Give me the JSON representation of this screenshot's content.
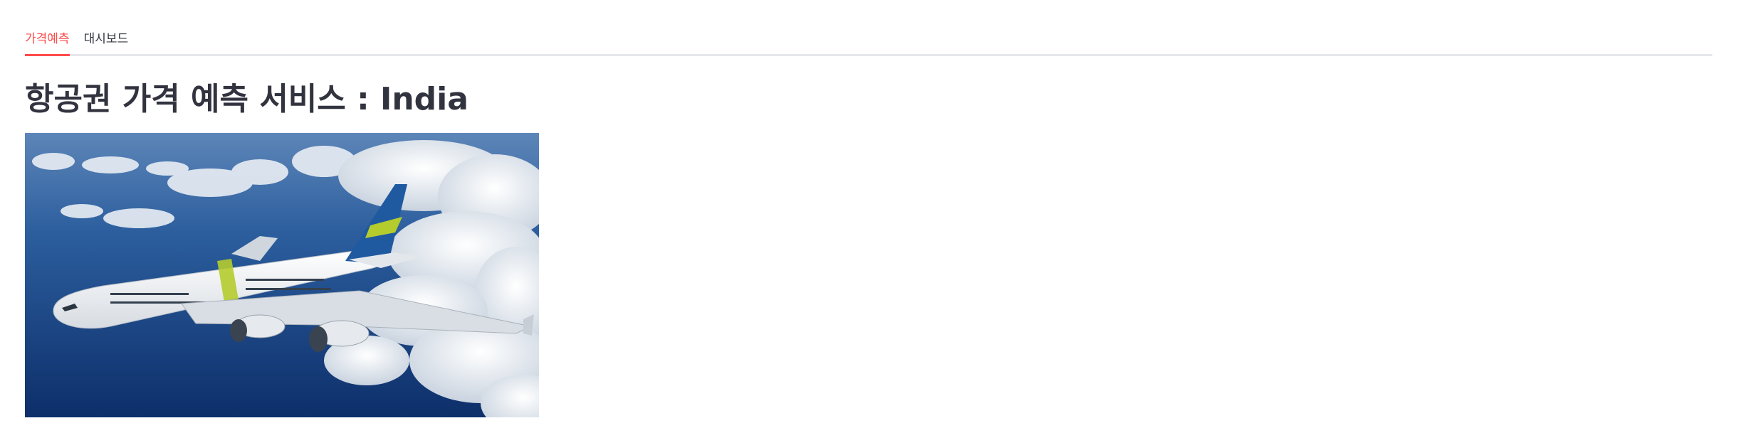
{
  "tabs": [
    {
      "label": "가격예측",
      "active": true
    },
    {
      "label": "대시보드",
      "active": false
    }
  ],
  "page": {
    "title": "항공권 가격 예측 서비스 : India"
  },
  "colors": {
    "accent": "#ff4b4b",
    "text": "#31333f",
    "divider": "#e6e7ea"
  }
}
